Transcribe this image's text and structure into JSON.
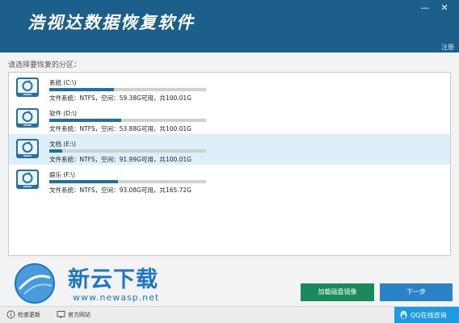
{
  "app": {
    "title": "浩视达数据恢复软件",
    "register": "注册"
  },
  "window": {
    "minimize_glyph": "—",
    "close_glyph": "✕"
  },
  "main": {
    "prompt": "请选择要恢复的分区："
  },
  "partitions": [
    {
      "name": "系统 (C:\\)",
      "info": "文件系统：NTFS，空间：59.38G可用，共100.01G",
      "used_fraction": 0.41,
      "selected": false,
      "icon": "hard-disk-icon"
    },
    {
      "name": "软件 (D:\\)",
      "info": "文件系统：NTFS，空间：53.88G可用，共100.01G",
      "used_fraction": 0.46,
      "selected": false,
      "icon": "hard-disk-icon"
    },
    {
      "name": "文档 (E:\\)",
      "info": "文件系统：NTFS，空间：91.99G可用，共100.01G",
      "used_fraction": 0.08,
      "selected": true,
      "icon": "hard-disk-icon"
    },
    {
      "name": "娱乐 (F:\\)",
      "info": "文件系统：NTFS，空间：93.08G可用，共165.72G",
      "used_fraction": 0.44,
      "selected": false,
      "icon": "hard-disk-icon"
    }
  ],
  "buttons": {
    "load_image": "加载磁盘镜像",
    "next": "下一步"
  },
  "watermark": {
    "name": "新云下载",
    "url": "www.newasp.net"
  },
  "footer": {
    "check_update": "检查更新",
    "website": "官方网站",
    "qq": "QQ在线咨询"
  },
  "colors": {
    "titlebar": "#1b5f8a",
    "progress": "#1d6fa6",
    "selected_row": "#ddf0fa",
    "load_image_button": "#1a8a5a",
    "next_button": "#2a82c8",
    "qq_button": "#1e9be0"
  }
}
